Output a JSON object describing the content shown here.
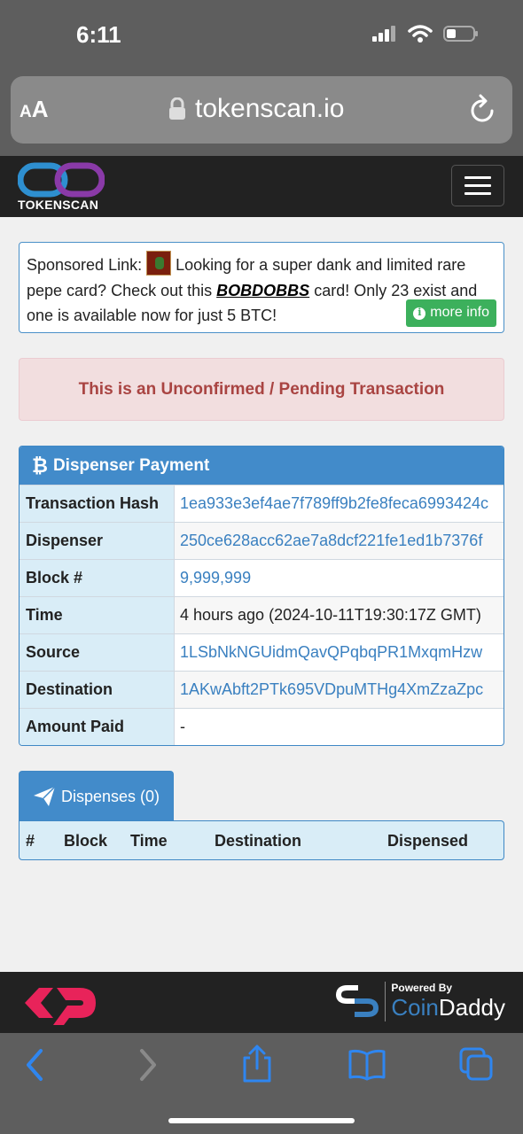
{
  "status_bar": {
    "time": "6:11"
  },
  "browser": {
    "aa_large": "A",
    "aa_small": "A",
    "url": "tokenscan.io"
  },
  "site": {
    "logo_text": "TOKENSCAN"
  },
  "sponsored": {
    "prefix": "Sponsored Link:",
    "text_before": "Looking for a super dank and limited rare pepe card? Check out this",
    "card_name": "BOBDOBBS",
    "text_after": "card! Only 23 exist and one is available now for just 5 BTC!",
    "more_info_label": "more info",
    "info_glyph": "i"
  },
  "alert": {
    "text": "This is an Unconfirmed / Pending Transaction"
  },
  "panel": {
    "btc_symbol": "₿",
    "title": "Dispenser Payment",
    "rows": [
      {
        "label": "Transaction Hash",
        "value": "1ea933e3ef4ae7f789ff9b2fe8feca6993424c"
      },
      {
        "label": "Dispenser",
        "value": "250ce628acc62ae7a8dcf221fe1ed1b7376f"
      },
      {
        "label": "Block #",
        "value": "9,999,999"
      },
      {
        "label": "Time",
        "value": "4 hours ago (2024-10-11T19:30:17Z GMT)"
      },
      {
        "label": "Source",
        "value": "1LSbNkNGUidmQavQPqbqPR1MxqmHzw"
      },
      {
        "label": "Destination",
        "value": "1AKwAbft2PTk695VDpuMTHg4XmZzaZpc"
      },
      {
        "label": "Amount Paid",
        "value": "-"
      }
    ]
  },
  "dispenses": {
    "tab_label": "Dispenses (0)",
    "columns": [
      "#",
      "Block",
      "Time",
      "Destination",
      "Dispensed"
    ]
  },
  "footer": {
    "powered_by": "Powered By",
    "brand_coin": "Coin",
    "brand_daddy": "Daddy"
  },
  "icons": [
    "lock-icon",
    "reload-icon",
    "hamburger-icon",
    "paper-plane-icon",
    "back-icon",
    "forward-icon",
    "share-icon",
    "bookmarks-icon",
    "tabs-icon"
  ],
  "colors": {
    "panel_blue": "#428bca",
    "link_blue": "#3a80c0",
    "alert_red": "#a94442",
    "success_green": "#3cb05c",
    "header_dark": "#222222"
  }
}
